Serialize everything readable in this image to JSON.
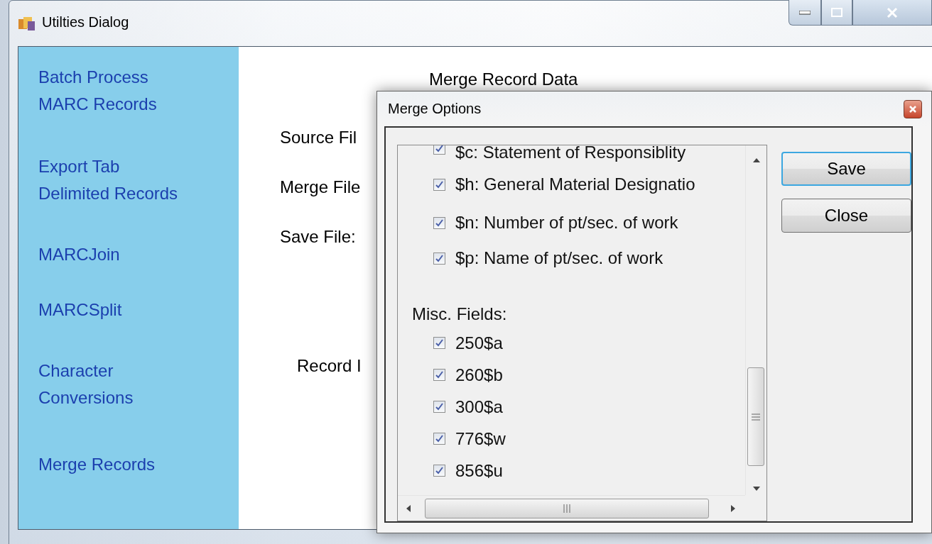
{
  "window": {
    "title": "Utilties Dialog"
  },
  "sidebar": {
    "items": [
      "Batch Process\nMARC Records",
      "Export Tab\nDelimited Records",
      "MARCJoin",
      "MARCSplit",
      "Character\nConversions",
      "Merge Records"
    ]
  },
  "content": {
    "heading": "Merge Record Data",
    "labels": [
      "Source Fil",
      "Merge File",
      "Save File:",
      "Record I"
    ]
  },
  "dialog": {
    "title": "Merge Options",
    "list": [
      {
        "kind": "checkbox",
        "label": "$c: Statement of Responsiblity",
        "checked": true
      },
      {
        "kind": "checkbox",
        "label": "$h: General Material Designatio",
        "checked": true
      },
      {
        "kind": "checkbox",
        "label": "$n: Number of pt/sec. of work",
        "checked": true
      },
      {
        "kind": "checkbox",
        "label": "$p: Name of pt/sec. of work",
        "checked": true
      },
      {
        "kind": "heading",
        "label": "Misc. Fields:"
      },
      {
        "kind": "checkbox",
        "label": "250$a",
        "checked": true
      },
      {
        "kind": "checkbox",
        "label": "260$b",
        "checked": true
      },
      {
        "kind": "checkbox",
        "label": "300$a",
        "checked": true
      },
      {
        "kind": "checkbox",
        "label": "776$w",
        "checked": true
      },
      {
        "kind": "checkbox",
        "label": "856$u",
        "checked": true
      }
    ],
    "buttons": [
      {
        "label": "Save",
        "focused": true
      },
      {
        "label": "Close",
        "focused": false
      }
    ]
  }
}
